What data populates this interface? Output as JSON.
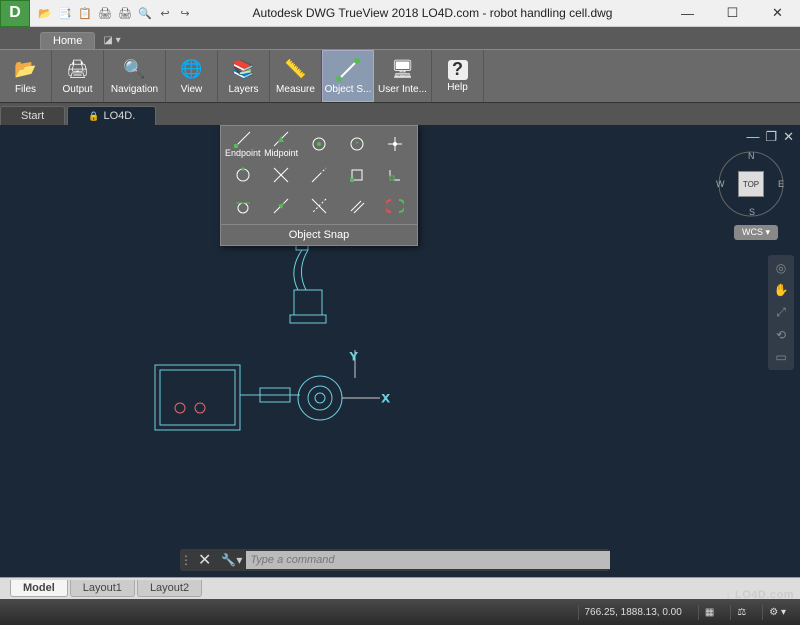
{
  "window": {
    "app_letter": "D",
    "title": "Autodesk DWG TrueView 2018     LO4D.com - robot handling cell.dwg",
    "minimize": "—",
    "maximize": "☐",
    "close": "✕"
  },
  "qat": [
    "📂",
    "📑",
    "📋",
    "🖨",
    "🖨",
    "🔍",
    "↩",
    "↪"
  ],
  "tabs": {
    "home": "Home"
  },
  "ribbon": [
    {
      "name": "files",
      "label": "Files",
      "icon": "📂",
      "color": "#f2c24b"
    },
    {
      "name": "output",
      "label": "Output",
      "icon": "🖨",
      "color": "#ddd"
    },
    {
      "name": "navigation",
      "label": "Navigation",
      "icon": "🔍",
      "color": "#ddd"
    },
    {
      "name": "view",
      "label": "View",
      "icon": "🌐",
      "color": "#cfa"
    },
    {
      "name": "layers",
      "label": "Layers",
      "icon": "📚",
      "color": "#9cf"
    },
    {
      "name": "measure",
      "label": "Measure",
      "icon": "📏",
      "color": "#fd8"
    },
    {
      "name": "object-snap",
      "label": "Object S...",
      "icon": "⟋",
      "color": "#7c9",
      "active": true
    },
    {
      "name": "user-interface",
      "label": "User Inte...",
      "icon": "🖥",
      "color": "#ccc"
    },
    {
      "name": "help",
      "label": "Help",
      "icon": "?",
      "color": "#ddd"
    }
  ],
  "doc_tabs": [
    {
      "label": "Start",
      "active": false,
      "locked": false
    },
    {
      "label": "LO4D.",
      "active": true,
      "locked": true
    }
  ],
  "snap_panel": {
    "title": "Object Snap",
    "items": [
      {
        "name": "endpoint",
        "label": "Endpoint"
      },
      {
        "name": "midpoint",
        "label": "Midpoint"
      },
      {
        "name": "center",
        "label": ""
      },
      {
        "name": "geometric-center",
        "label": ""
      },
      {
        "name": "node",
        "label": ""
      },
      {
        "name": "quadrant",
        "label": ""
      },
      {
        "name": "intersection",
        "label": ""
      },
      {
        "name": "extension",
        "label": ""
      },
      {
        "name": "insertion",
        "label": ""
      },
      {
        "name": "perpendicular",
        "label": ""
      },
      {
        "name": "tangent",
        "label": ""
      },
      {
        "name": "nearest",
        "label": ""
      },
      {
        "name": "apparent-intersection",
        "label": ""
      },
      {
        "name": "parallel",
        "label": ""
      },
      {
        "name": "enabled",
        "label": ""
      }
    ]
  },
  "viewcube": {
    "top": "TOP",
    "n": "N",
    "s": "S",
    "e": "E",
    "w": "W"
  },
  "wcs": "WCS",
  "axes": {
    "x": "X",
    "y": "Y"
  },
  "cmdline": {
    "placeholder": "Type a command"
  },
  "bottom_tabs": [
    {
      "label": "Model",
      "active": true
    },
    {
      "label": "Layout1",
      "active": false
    },
    {
      "label": "Layout2",
      "active": false
    }
  ],
  "status": {
    "coords": "766.25, 1888.13, 0.00"
  },
  "watermark": "↓ LO4D.com"
}
